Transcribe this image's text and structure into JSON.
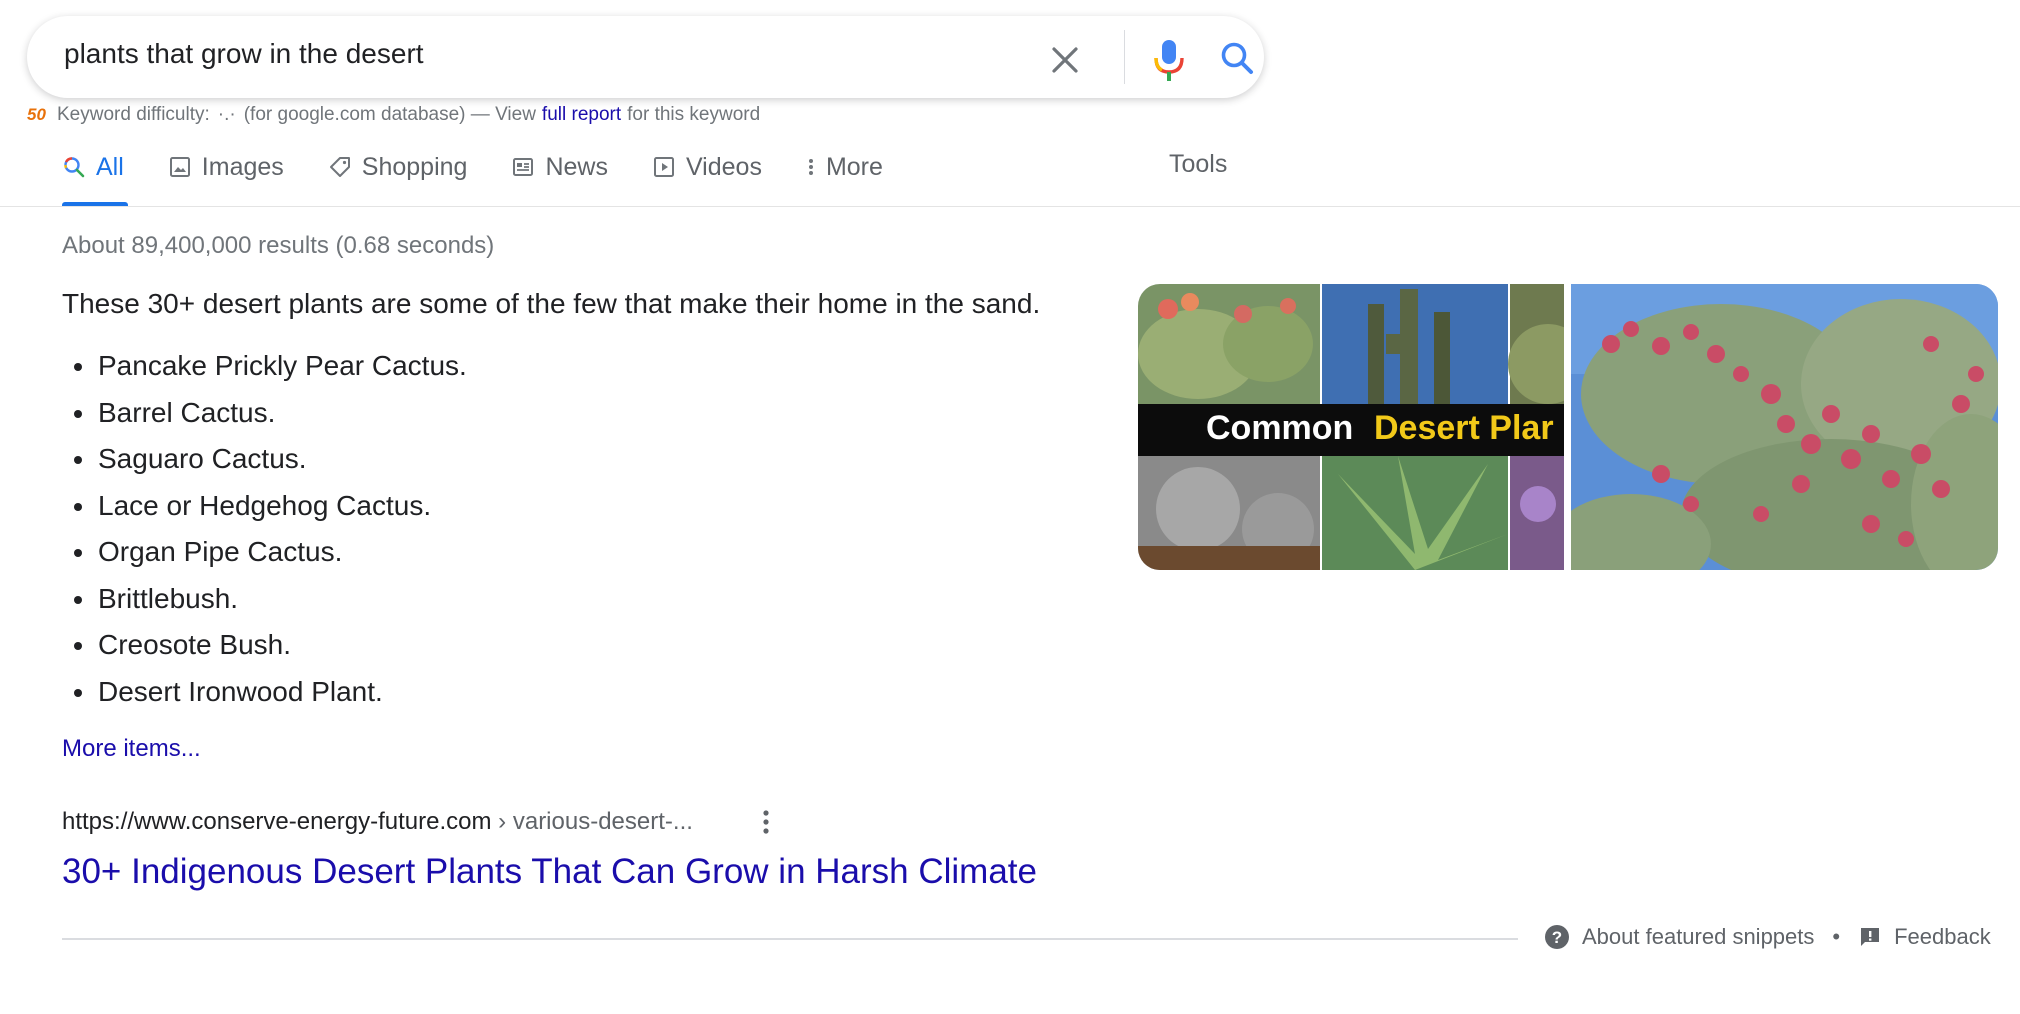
{
  "search": {
    "query": "plants that grow in the desert"
  },
  "keyword_difficulty": {
    "logo_text": "50",
    "label": "Keyword difficulty:",
    "dots": "·.·",
    "database_note": "(for google.com database) — View",
    "link_text": "full report",
    "suffix": "for this keyword"
  },
  "tabs": [
    {
      "label": "All",
      "icon": "search-icon",
      "active": true
    },
    {
      "label": "Images",
      "icon": "image-icon"
    },
    {
      "label": "Shopping",
      "icon": "tag-icon"
    },
    {
      "label": "News",
      "icon": "news-icon"
    },
    {
      "label": "Videos",
      "icon": "play-icon"
    },
    {
      "label": "More",
      "icon": "more-vert-icon"
    }
  ],
  "tools_label": "Tools",
  "result_stats": "About 89,400,000 results (0.68 seconds)",
  "snippet": {
    "heading": "These 30+ desert plants are some of the few that make their home in the sand.",
    "items": [
      "Pancake Prickly Pear Cactus.",
      "Barrel Cactus.",
      "Saguaro Cactus.",
      "Lace or Hedgehog Cactus.",
      "Organ Pipe Cactus.",
      "Brittlebush.",
      "Creosote Bush.",
      "Desert Ironwood Plant."
    ],
    "more_items": "More items...",
    "image1_caption_white": "Common",
    "image1_caption_yellow": "Desert Plar"
  },
  "result": {
    "url_domain": "https://www.conserve-energy-future.com",
    "url_path": " › various-desert-...",
    "title": "30+ Indigenous Desert Plants That Can Grow in Harsh Climate"
  },
  "footer": {
    "about": "About featured snippets",
    "separator": "•",
    "feedback": "Feedback"
  },
  "colors": {
    "link": "#1a0dab",
    "accent": "#1a73e8",
    "muted": "#70757a"
  }
}
